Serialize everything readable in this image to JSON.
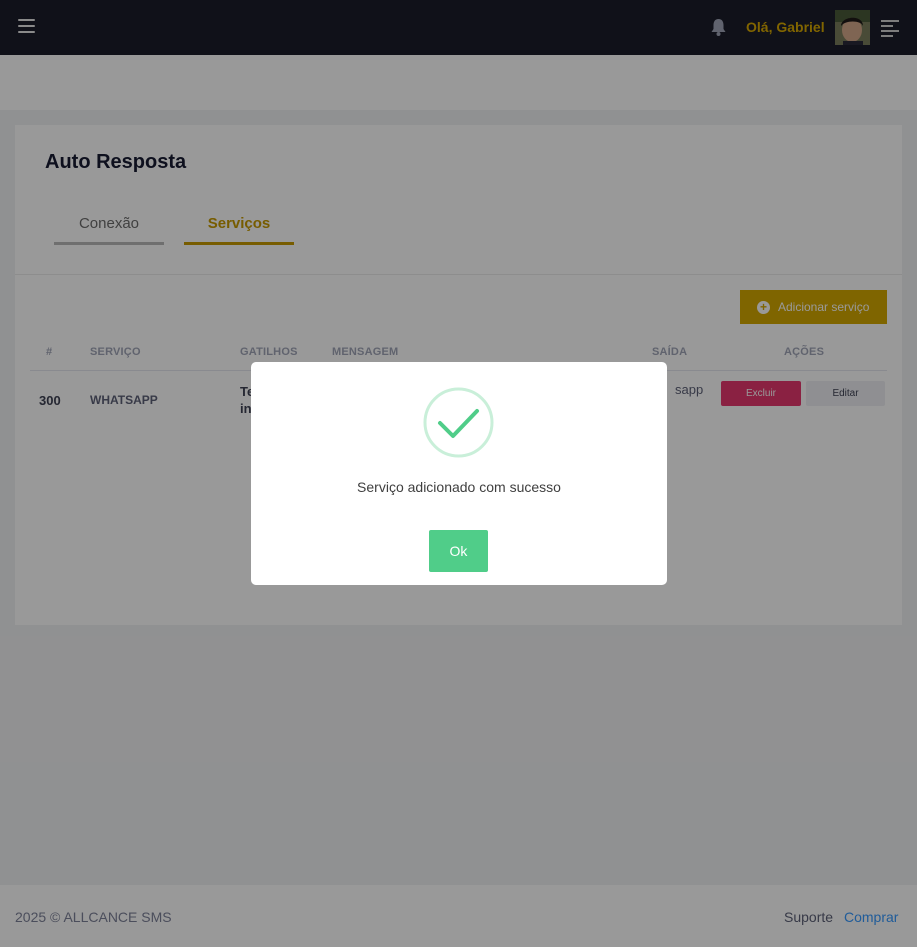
{
  "header": {
    "greeting": "Olá, Gabriel",
    "icons": {
      "menu": "hamburger-icon",
      "notifications": "bell-icon",
      "aside": "menu-lines-icon"
    },
    "accent_color": "#d8a800"
  },
  "page": {
    "title": "Auto Resposta",
    "tabs": [
      {
        "label": "Conexão",
        "active": false
      },
      {
        "label": "Serviços",
        "active": true
      }
    ],
    "add_button": "Adicionar serviço"
  },
  "table": {
    "columns": [
      "#",
      "SERVIÇO",
      "GATILHOS",
      "MENSAGEM",
      "SAÍDA",
      "AÇÕES"
    ],
    "rows": [
      {
        "id": "300",
        "service": "WHATSAPP",
        "triggers_visible": [
          "Te",
          "in"
        ],
        "message": "",
        "output_visible": "sapp",
        "actions": [
          "Excluir",
          "Editar"
        ]
      }
    ]
  },
  "footer": {
    "copyright": "2025 © ALLCANCE SMS",
    "links": [
      "Suporte",
      "Comprar"
    ]
  },
  "modal": {
    "icon": "success-check-icon",
    "message": "Serviço adicionado com sucesso",
    "ok_label": "Ok",
    "success_color": "#50cd89"
  }
}
